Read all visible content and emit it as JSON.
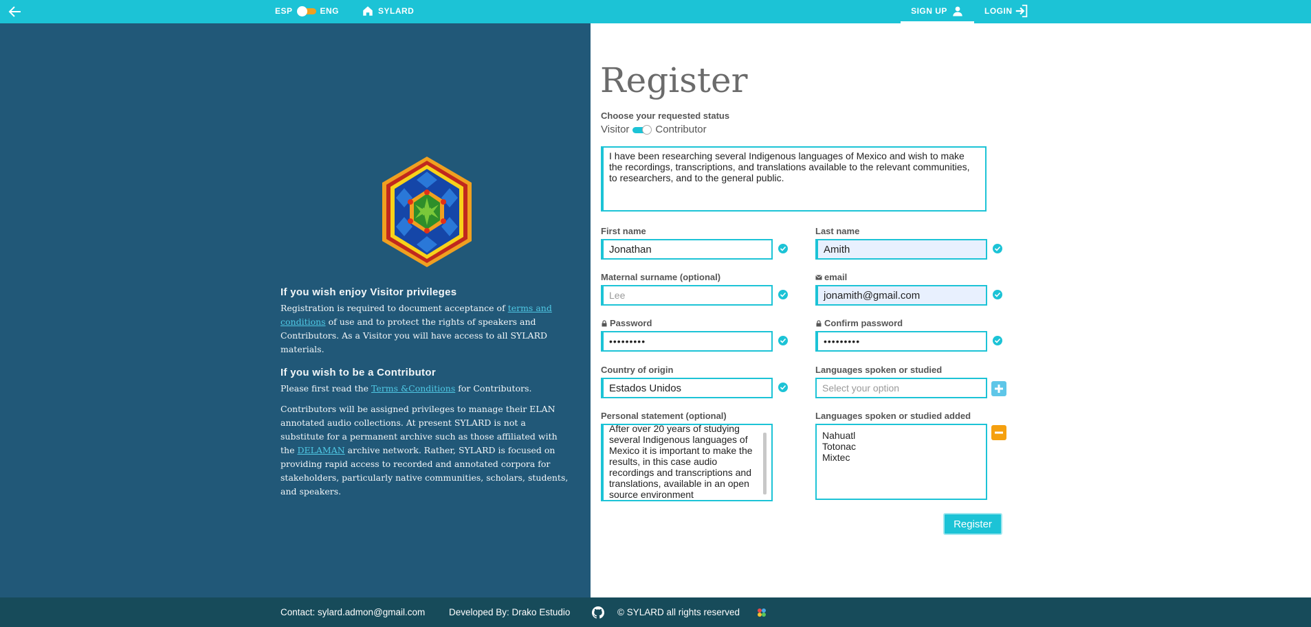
{
  "topbar": {
    "lang_left": "ESP",
    "lang_right": "ENG",
    "home_label": "SYLARD",
    "signup_label": "SIGN UP",
    "login_label": "LOGIN"
  },
  "info": {
    "visitor_heading": "If you wish enjoy Visitor privileges",
    "visitor_text_1": "Registration is required to document acceptance of ",
    "visitor_link": "terms and conditions",
    "visitor_text_2": " of use and to protect the rights of speakers and Contributors. As a Visitor you will have access to all SYLARD materials.",
    "contrib_heading": "If you wish to be a Contributor",
    "contrib_text_1": "Please first read the ",
    "contrib_link": "Terms &Conditions",
    "contrib_text_2": " for Contributors.",
    "priv_text_1": "Contributors will be assigned privileges to manage their ELAN annotated audio collections. At present SYLARD is not a substitute for a permanent archive such as those affiliated with the ",
    "priv_link": "DELAMAN",
    "priv_text_2": " archive network. Rather, SYLARD is focused on providing rapid access to recorded and annotated corpora for stakeholders, particularly native communities, scholars, students, and speakers."
  },
  "form": {
    "title": "Register",
    "status_label": "Choose your requested status",
    "status_left": "Visitor",
    "status_right": "Contributor",
    "reason_text": "I have been researching several Indigenous languages of Mexico and wish to make the recordings, transcriptions, and translations available to the relevant communities, to researchers, and to the general public.",
    "first_name_label": "First name",
    "first_name_value": "Jonathan",
    "last_name_label": "Last name",
    "last_name_value": "Amith",
    "maternal_label": "Maternal surname (optional)",
    "maternal_placeholder": "Lee",
    "email_label": "email",
    "email_value": "jonamith@gmail.com",
    "password_label": "Password",
    "password_value": "•••••••••",
    "confirm_label": "Confirm password",
    "confirm_value": "•••••••••",
    "country_label": "Country of origin",
    "country_value": "Estados Unidos",
    "languages_label": "Languages spoken or studied",
    "languages_placeholder": "Select your option",
    "statement_label": "Personal statement (optional)",
    "statement_text": "After over 20 years of studying several Indigenous languages of Mexico it is important to make the results, in this case audio recordings and transcriptions and translations, available in an open source environment",
    "languages_added_label": "Languages spoken or studied added",
    "languages_added": [
      "Nahuatl",
      "Totonac",
      "Mixtec"
    ],
    "register_label": "Register"
  },
  "footer": {
    "contact": "Contact: sylard.admon@gmail.com",
    "developed": "Developed By: Drako Estudio",
    "copyright": "© SYLARD all rights reserved"
  },
  "colors": {
    "accent": "#1cc3d6",
    "left_panel": "#215878",
    "footer": "#174b5a",
    "plus_button": "#5ec6e8",
    "minus_button": "#f5a00f"
  }
}
